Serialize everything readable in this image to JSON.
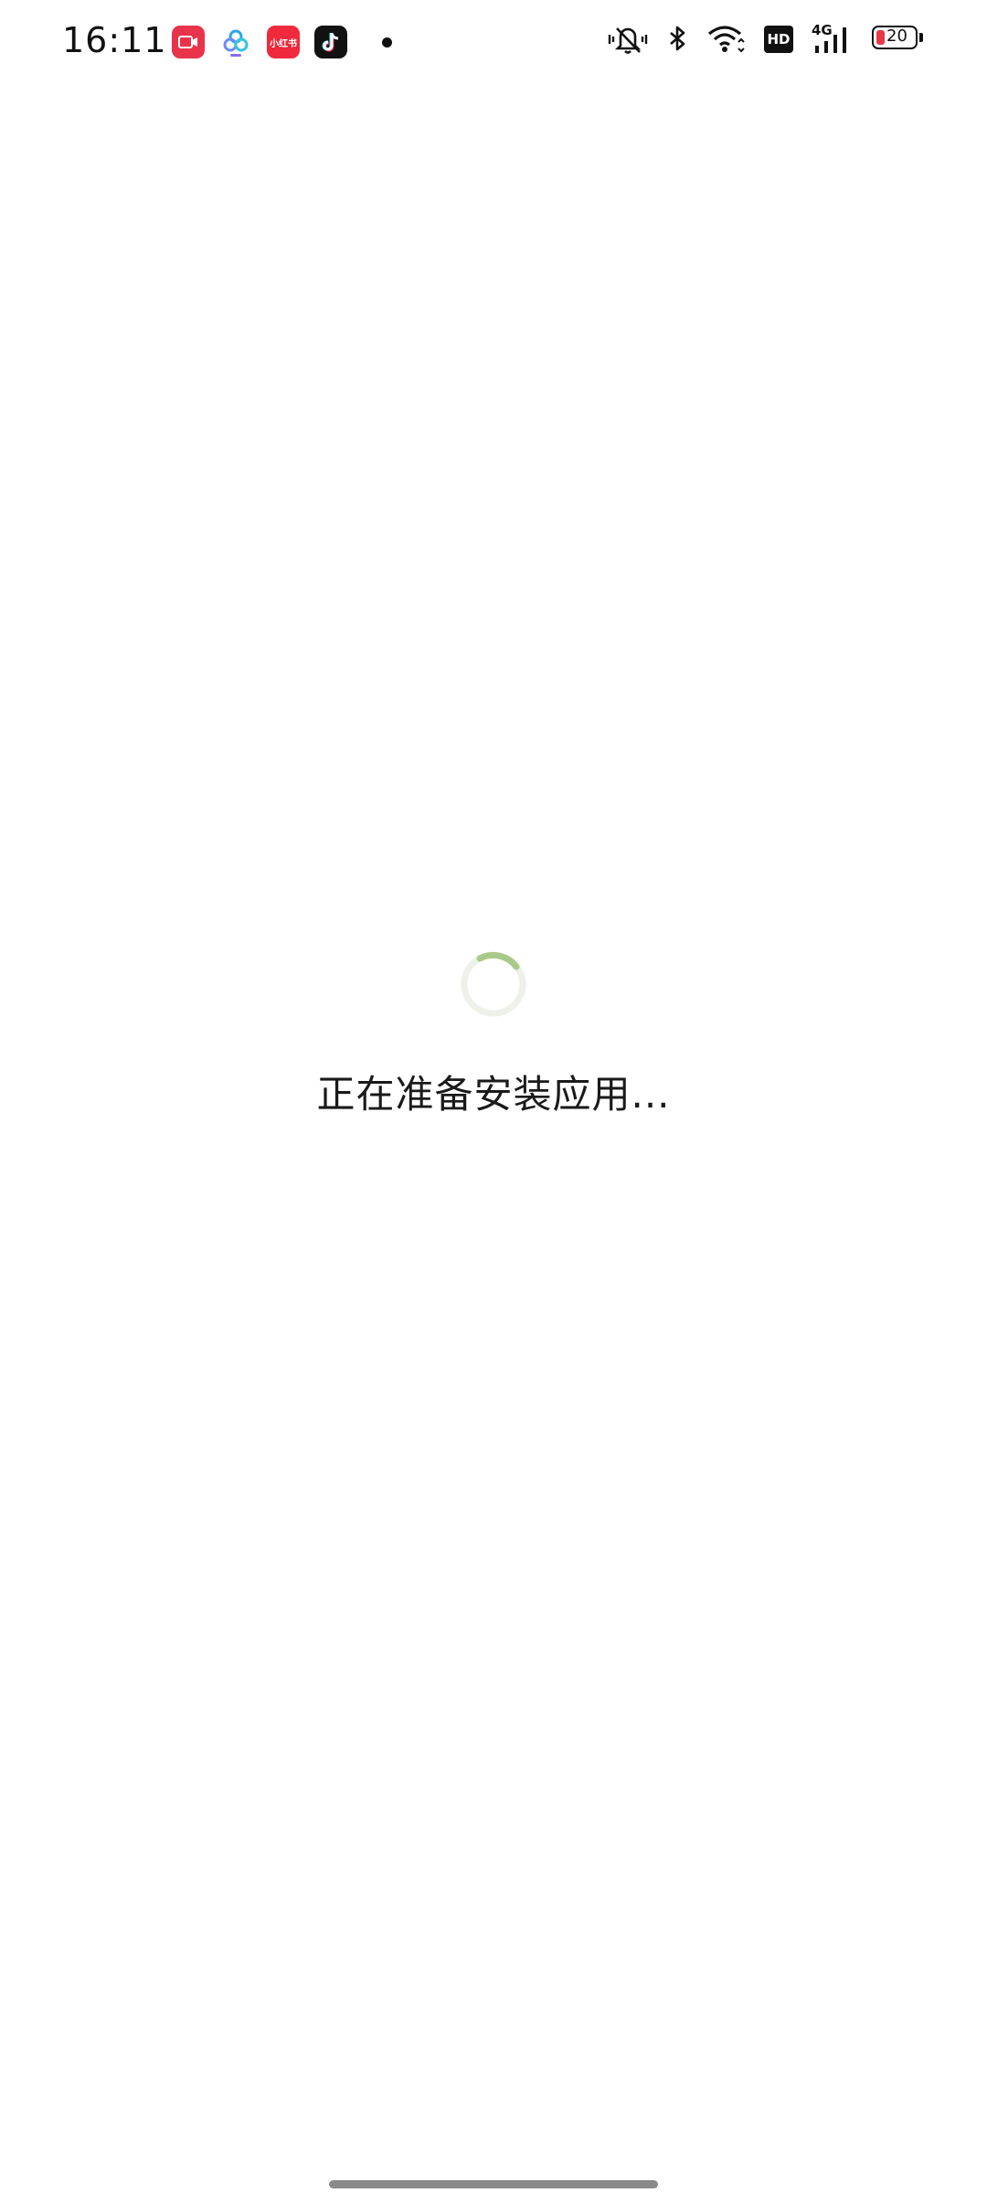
{
  "status_bar": {
    "time": "16:11",
    "battery_level": "20",
    "network_type": "4G",
    "hd_label": "HD",
    "notification_icons": [
      "screen-recorder-icon",
      "baidu-netdisk-icon",
      "xiaohongshu-icon",
      "douyin-icon"
    ],
    "xiaohongshu_label": "小红书",
    "system_icons": [
      "silent-mode-icon",
      "bluetooth-icon",
      "wifi-icon",
      "hd-icon",
      "signal-icon",
      "battery-icon"
    ]
  },
  "main": {
    "loading_text": "正在准备安装应用..."
  },
  "colors": {
    "spinner_accent": "#a8c98a",
    "spinner_track": "#eef1ea",
    "battery_low": "#e53945",
    "xiaohongshu_red": "#ee2a3c",
    "recorder_red": "#e8334a"
  }
}
